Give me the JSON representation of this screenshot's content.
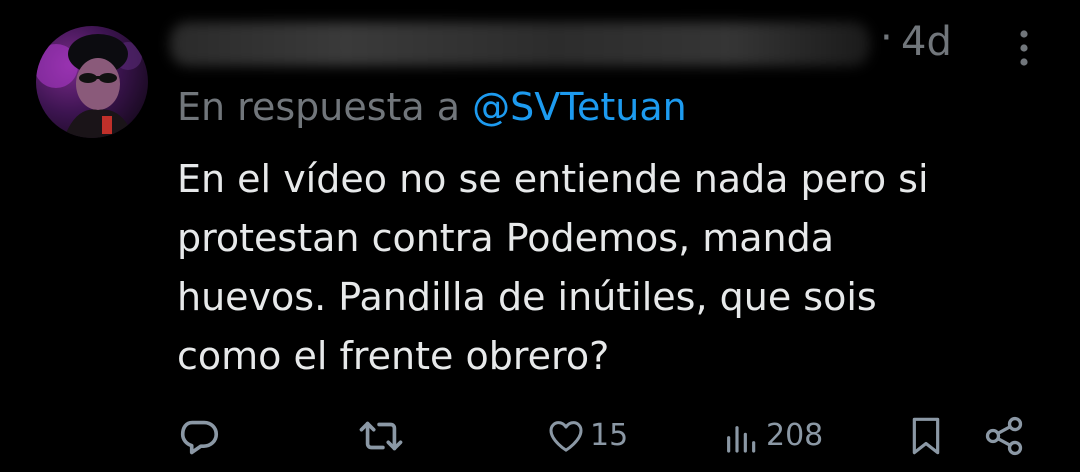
{
  "tweet": {
    "timestamp_separator": "·",
    "timestamp": "4d",
    "reply_prefix": "En respuesta a ",
    "reply_handle": "@SVTetuan",
    "body_lines": [
      "En el vídeo no se entiende nada pero si",
      "protestan contra Podemos, manda",
      "huevos. Pandilla de inútiles, que sois",
      "como el frente obrero?"
    ]
  },
  "actions": {
    "reply_icon": "reply-icon",
    "retweet_icon": "retweet-icon",
    "like_icon": "heart-icon",
    "like_count": "15",
    "views_icon": "views-icon",
    "views_count": "208",
    "bookmark_icon": "bookmark-icon",
    "share_icon": "share-icon"
  },
  "colors": {
    "background": "#000000",
    "text": "#e7e9ea",
    "muted": "#71767b",
    "mention": "#1d9bf0",
    "action_icons": "#8b98a5"
  }
}
